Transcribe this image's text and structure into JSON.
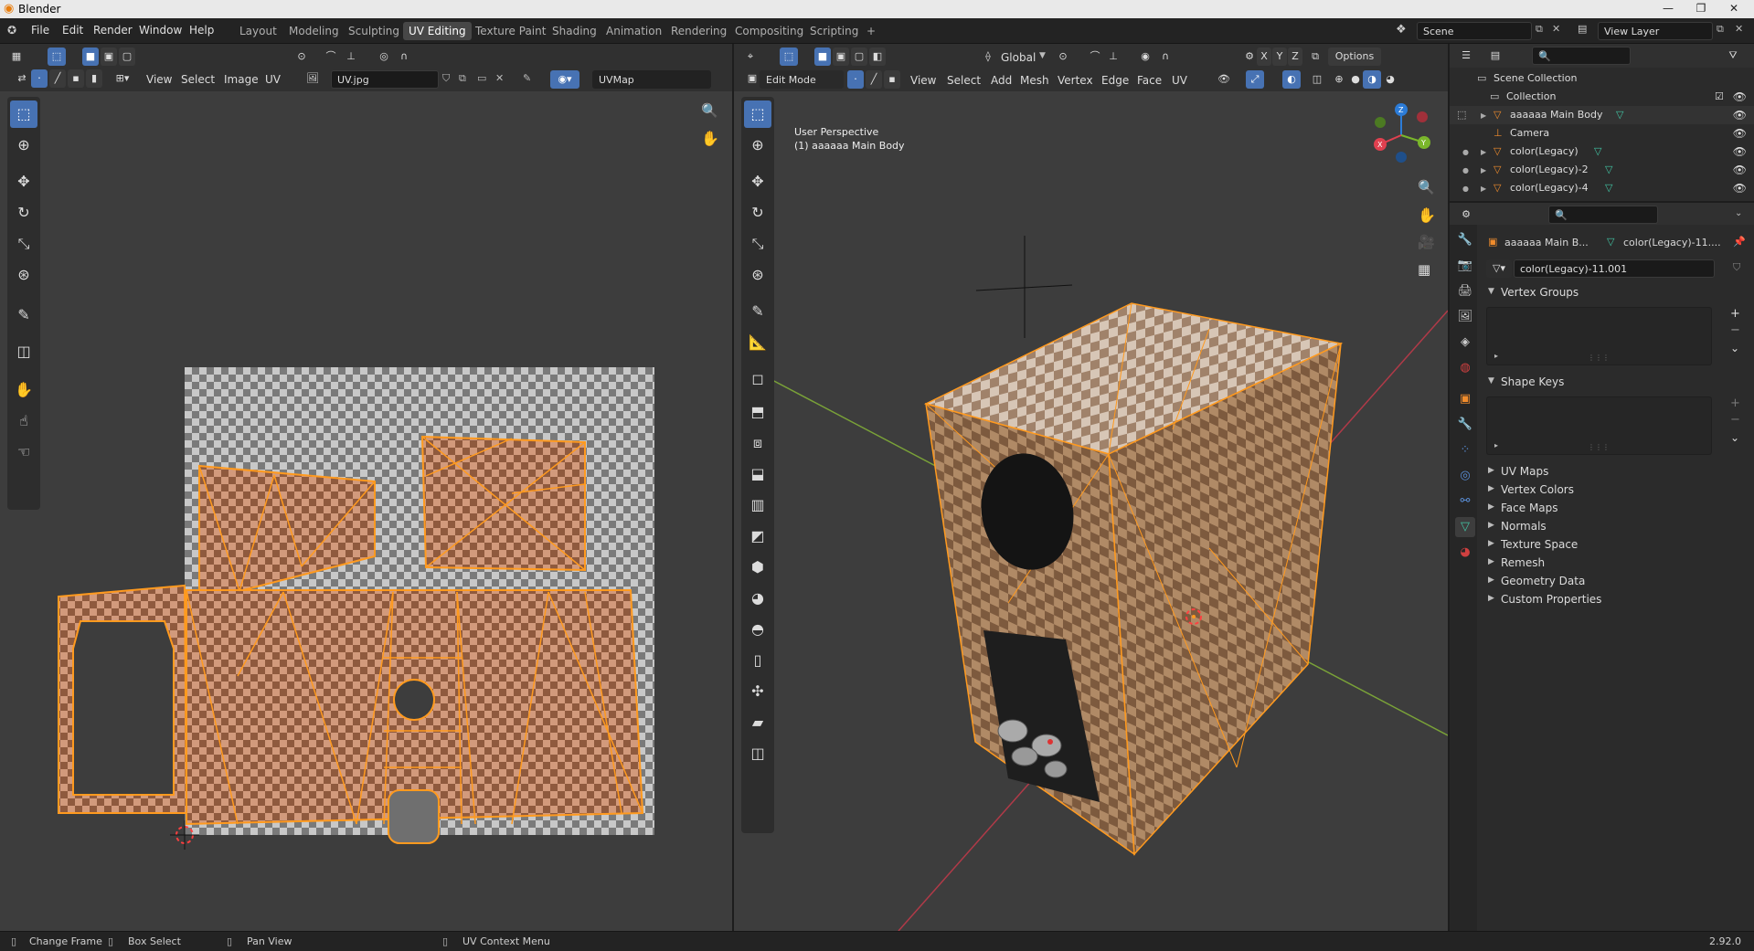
{
  "window": {
    "title": "Blender",
    "controls": [
      "—",
      "❐",
      "✕"
    ]
  },
  "topbar": {
    "menus": [
      "File",
      "Edit",
      "Render",
      "Window",
      "Help"
    ],
    "workspaces": [
      "Layout",
      "Modeling",
      "Sculpting",
      "UV Editing",
      "Texture Paint",
      "Shading",
      "Animation",
      "Rendering",
      "Compositing",
      "Scripting"
    ],
    "active_workspace": "UV Editing",
    "add_tab": "+",
    "scene": "Scene",
    "view_layer": "View Layer"
  },
  "uv_editor": {
    "menus": [
      "View",
      "Select",
      "Image",
      "UV"
    ],
    "image_name": "UV.jpg",
    "uv_map": "UVMap"
  },
  "viewport": {
    "mode": "Edit Mode",
    "menus": [
      "View",
      "Select",
      "Add",
      "Mesh",
      "Vertex",
      "Edge",
      "Face",
      "UV"
    ],
    "transform_orientation": "Global",
    "options_label": "Options",
    "axis_buttons": [
      "X",
      "Y",
      "Z"
    ],
    "overlay_title": "User Perspective",
    "overlay_object": "(1) aaaaaa  Main Body",
    "gizmo_labels": [
      "X",
      "Y",
      "Z"
    ]
  },
  "outliner": {
    "root": "Scene Collection",
    "items": [
      {
        "label": "Collection",
        "icon": "collection-icon",
        "checked": true
      },
      {
        "label": "aaaaaa  Main Body",
        "icon": "mesh-object-icon"
      },
      {
        "label": "Camera",
        "icon": "camera-icon"
      },
      {
        "label": "color(Legacy)",
        "icon": "mesh-object-icon"
      },
      {
        "label": "color(Legacy)-2",
        "icon": "mesh-object-icon"
      },
      {
        "label": "color(Legacy)-4",
        "icon": "mesh-object-icon"
      }
    ]
  },
  "properties": {
    "object_name": "aaaaaa  Main B...",
    "data_name_short": "color(Legacy)-11....",
    "mesh_data": "color(Legacy)-11.001",
    "panels_open": [
      "Vertex Groups",
      "Shape Keys"
    ],
    "panels_closed": [
      "UV Maps",
      "Vertex Colors",
      "Face Maps",
      "Normals",
      "Texture Space",
      "Remesh",
      "Geometry Data",
      "Custom Properties"
    ],
    "list_controls": [
      "+",
      "−",
      "⌄"
    ],
    "collapsed_marker": "▸",
    "grip": "⋮⋮⋮"
  },
  "statusbar": {
    "items": [
      "Change Frame",
      "Box Select",
      "Pan View",
      "UV Context Menu"
    ],
    "version": "2.92.0"
  },
  "colors": {
    "accent": "#4772b3",
    "uv_edge": "#ff9a1f",
    "uv_face": "#d88a62",
    "active_tab": "#474747"
  }
}
